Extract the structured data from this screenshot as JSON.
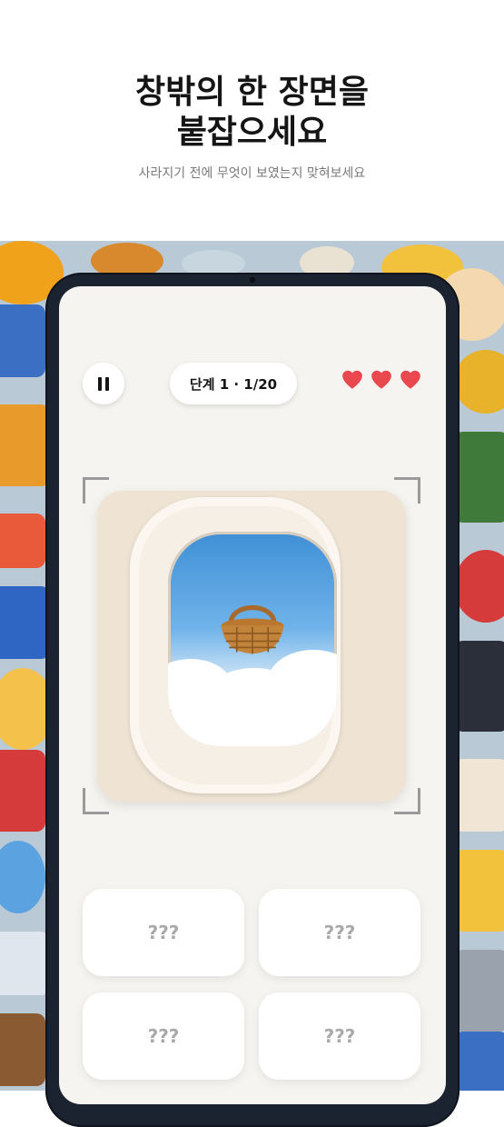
{
  "header": {
    "title_line1": "창밖의 한 장면을",
    "title_line2": "붙잡으세요",
    "subtitle": "사라지기 전에 무엇이 보였는지 맞혀보세요"
  },
  "game": {
    "pause_icon": "pause-icon",
    "level_label": "단계 1 · 1/20",
    "lives": 3,
    "heart_color": "#e8484e",
    "scene_item_icon": "basket-icon",
    "answers": [
      "???",
      "???",
      "???",
      "???"
    ]
  }
}
